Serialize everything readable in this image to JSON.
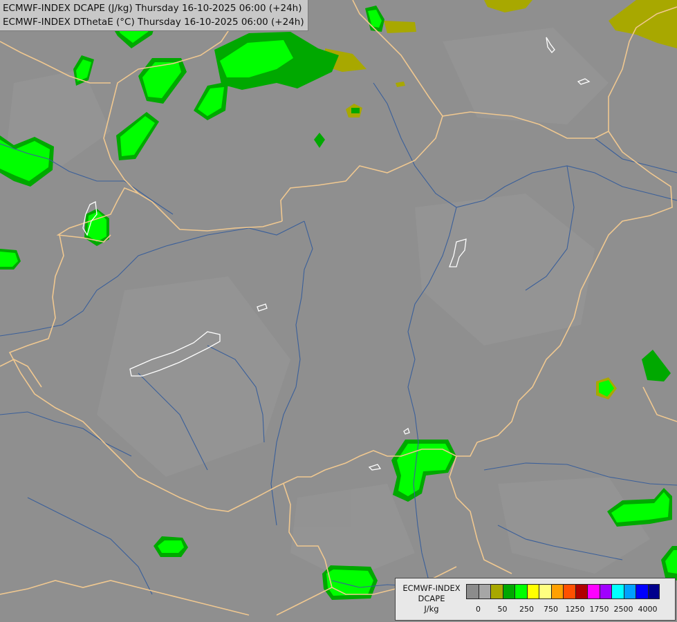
{
  "header": {
    "line1": "ECMWF-INDEX DCAPE (J/kg) Thursday 16-10-2025 06:00 (+24h)",
    "line2": "ECMWF-INDEX DThetaE (°C) Thursday 16-10-2025 06:00 (+24h)"
  },
  "legend": {
    "title_line1": "ECMWF-INDEX",
    "title_line2": "DCAPE",
    "title_line3": "J/kg",
    "colors": [
      "#8c8c8c",
      "#a6a6a6",
      "#a8a800",
      "#00a800",
      "#00ff00",
      "#ffff00",
      "#ffff80",
      "#ffa000",
      "#ff5000",
      "#b00000",
      "#ff00ff",
      "#a000ff",
      "#00ffff",
      "#00a0ff",
      "#0000ff",
      "#00008c"
    ],
    "ticks": [
      "0",
      "50",
      "250",
      "750",
      "1250",
      "1750",
      "2500",
      "4000"
    ]
  },
  "palette": {
    "background": "#8f8f8f",
    "border": "#f0c890",
    "river": "#3060a0",
    "lake": "#ffffff"
  }
}
